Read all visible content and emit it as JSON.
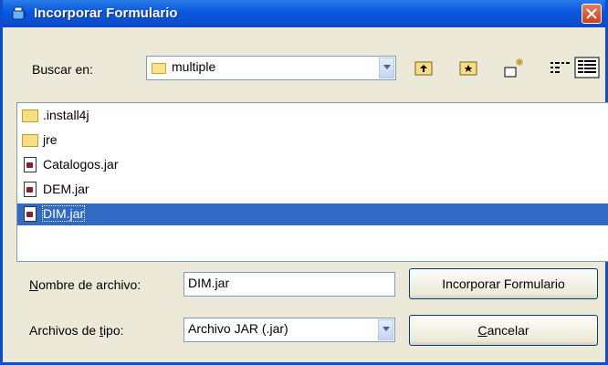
{
  "window": {
    "title": "Incorporar Formulario",
    "title_icon": "java-cup-icon",
    "close_icon": "close-icon"
  },
  "look_in": {
    "label": "Buscar en:",
    "selected": "multiple",
    "toolbar_icons": [
      "up-one-level-icon",
      "home-folder-icon",
      "new-folder-icon",
      "list-view-icon",
      "details-view-icon"
    ]
  },
  "files": [
    {
      "name": ".install4j",
      "type": "folder"
    },
    {
      "name": "jre",
      "type": "folder"
    },
    {
      "name": "Catalogos.jar",
      "type": "jar"
    },
    {
      "name": "DEM.jar",
      "type": "jar"
    },
    {
      "name": "DIM.jar",
      "type": "jar",
      "selected": true
    }
  ],
  "filename": {
    "label_accel": "N",
    "label_rest": "ombre de archivo:",
    "value": "DIM.jar"
  },
  "filetype": {
    "label_pre": "Archivos de ",
    "label_accel": "t",
    "label_post": "ipo:",
    "selected": "Archivo JAR (.jar)"
  },
  "buttons": {
    "approve": "Incorporar Formulario",
    "cancel_accel": "C",
    "cancel_rest": "ancelar"
  },
  "colors": {
    "titlebar": "#0a5ae0",
    "selection": "#316ac5",
    "dialog_bg": "#ece9d8"
  }
}
